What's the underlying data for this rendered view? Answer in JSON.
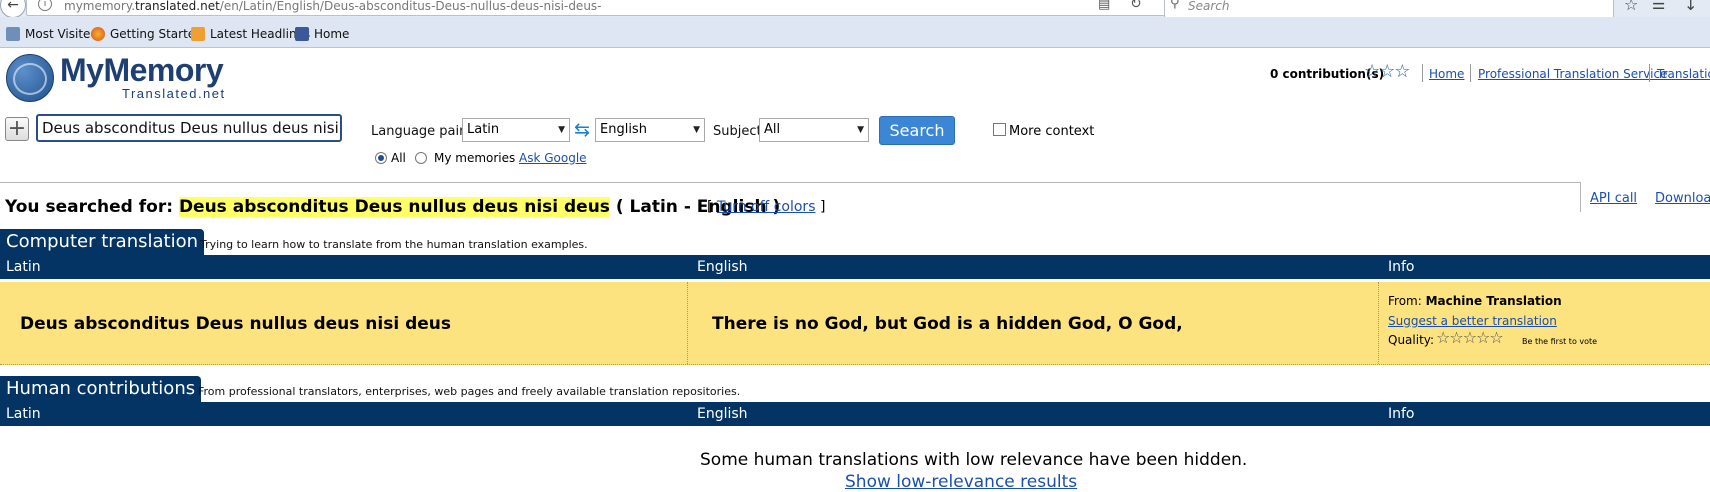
{
  "browser": {
    "url_prefix": "mymemory.",
    "url_host": "translated.net",
    "url_path": "/en/Latin/English/Deus-absconditus-Deus-nullus-deus-nisi-deus-",
    "search_placeholder": "Search",
    "bookmarks": [
      {
        "label": "Most Visited",
        "icon": "most-visited-icon"
      },
      {
        "label": "Getting Started",
        "icon": "firefox-icon"
      },
      {
        "label": "Latest Headlines",
        "icon": "rss-icon"
      },
      {
        "label": "Home",
        "icon": "facebook-icon"
      }
    ]
  },
  "header": {
    "logo_main": "MyMemory",
    "logo_sub": "Translated.net",
    "contributions": "0 contribution(s)",
    "contribution_stars": "☆☆☆",
    "links": [
      "Home",
      "Professional Translation Service",
      "Translation"
    ]
  },
  "search_form": {
    "query": "Deus absconditus Deus nullus deus nisi deus",
    "language_pair_label": "Language pair:",
    "source_lang": "Latin",
    "target_lang": "English",
    "subject_label": "Subject",
    "subject_value": "All",
    "search_button": "Search",
    "more_context_label": "More context",
    "radio_all": "All",
    "radio_my_memories": "My memories",
    "ask_google": "Ask Google"
  },
  "side_links": {
    "api_call": "API call",
    "download": "Download"
  },
  "results": {
    "searched_prefix": "You searched for:",
    "searched_query": "Deus absconditus Deus nullus deus nisi deus",
    "lang_pair_text": "( Latin - English )",
    "turn_off_open": "[",
    "turn_off_colors": "Turn off colors",
    "turn_off_close": "]",
    "computer": {
      "title": "Computer translation",
      "desc": "Trying to learn how to translate from the human translation examples.",
      "col_source": "Latin",
      "col_target": "English",
      "col_info": "Info",
      "source_text": "Deus absconditus Deus nullus deus nisi deus",
      "target_text": "There is no God, but God is a hidden God, O God,",
      "from_label": "From:",
      "from_value": "Machine Translation",
      "suggest_link": "Suggest a better translation",
      "quality_label": "Quality:",
      "quality_stars": "☆☆☆☆☆",
      "first_vote": "Be the first to vote"
    },
    "human": {
      "title": "Human contributions",
      "desc": "From professional translators, enterprises, web pages and freely available translation repositories.",
      "col_source": "Latin",
      "col_target": "English",
      "col_info": "Info",
      "hidden_msg": "Some human translations with low relevance have been hidden.",
      "show_low": "Show low-relevance results"
    }
  },
  "colors": {
    "nav_blue": "#033463",
    "result_yellow": "#fde280",
    "highlight": "#ffff66",
    "link": "#1a4fb0"
  }
}
